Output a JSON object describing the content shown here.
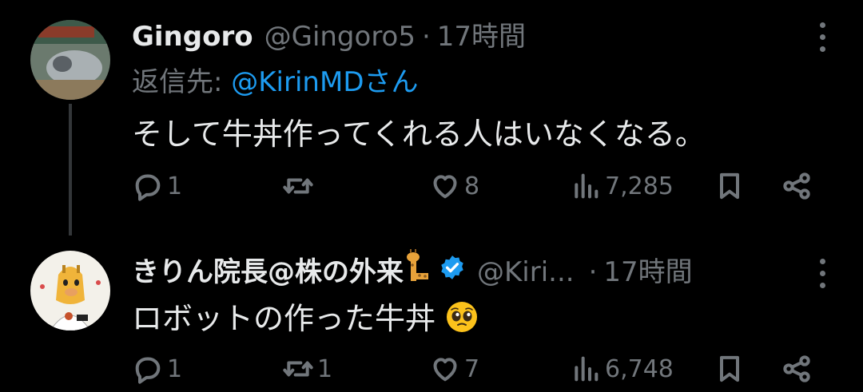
{
  "tweets": [
    {
      "name": "Gingoro",
      "handle": "@Gingoro5",
      "separator": "·",
      "time": "17時間",
      "replying_prefix": "返信先: ",
      "replying_mention": "@KirinMDさん",
      "text": "そして牛丼作ってくれる人はいなくなる。",
      "counts": {
        "reply": "1",
        "retweet": "",
        "like": "8",
        "views": "7,285"
      }
    },
    {
      "name": "きりん院長@株の外来",
      "handle": "@Kiri...",
      "separator": "·",
      "time": "17時間",
      "text": "ロボットの作った牛丼",
      "verified": true,
      "counts": {
        "reply": "1",
        "retweet": "1",
        "like": "7",
        "views": "6,748"
      }
    }
  ],
  "icons": [
    "more-icon",
    "reply-icon",
    "retweet-icon",
    "like-icon",
    "views-icon",
    "bookmark-icon",
    "share-icon",
    "verified-icon",
    "giraffe-emoji",
    "pleading-face-emoji"
  ],
  "colors": {
    "background": "#000000",
    "text": "#e7e9ea",
    "secondary": "#71767b",
    "accent": "#1d9bf0"
  }
}
